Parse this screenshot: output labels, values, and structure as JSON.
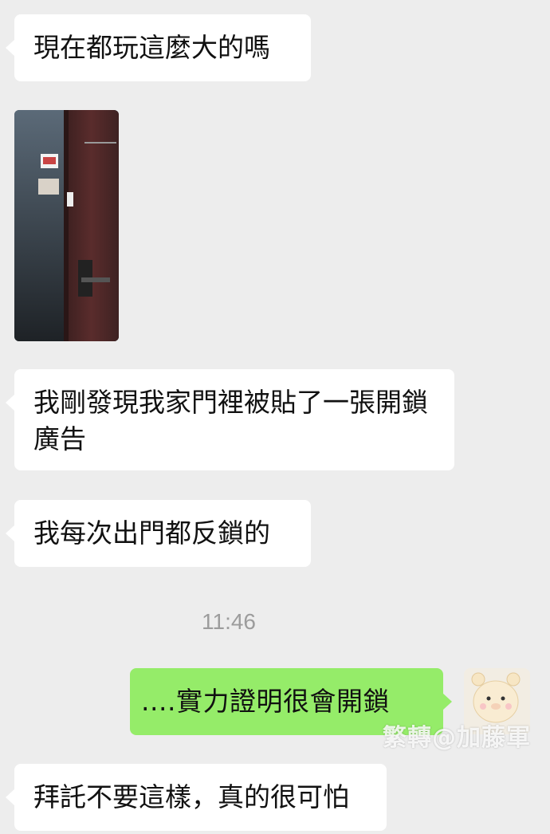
{
  "chat": {
    "messages": [
      {
        "from": "them",
        "type": "text",
        "text": "現在都玩這麼大的嗎"
      },
      {
        "from": "them",
        "type": "image",
        "icon": "door-photo"
      },
      {
        "from": "them",
        "type": "text",
        "text": "我剛發現我家門裡被貼了一張開鎖廣告"
      },
      {
        "from": "them",
        "type": "text",
        "text": "我每次出門都反鎖的"
      },
      {
        "from": "me",
        "type": "text",
        "text": "....實力證明很會開鎖"
      },
      {
        "from": "them",
        "type": "text",
        "text": "拜託不要這樣，真的很可怕"
      }
    ],
    "timestamp": "11:46",
    "watermark": "繁轉@加藤軍",
    "colors": {
      "background": "#ededed",
      "incoming_bubble": "#ffffff",
      "outgoing_bubble": "#95ec69"
    }
  }
}
